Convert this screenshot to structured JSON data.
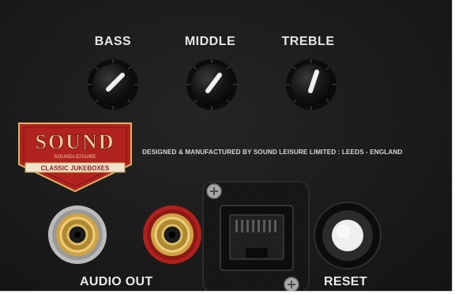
{
  "controls": {
    "bass_label": "BASS",
    "middle_label": "MIDDLE",
    "treble_label": "TREBLE"
  },
  "logo": {
    "brand": "SOUND",
    "subtitle": "SOUNDLEISURE",
    "banner": "CLASSIC JUKEBOXES"
  },
  "maker_text": "DESIGNED & MANUFACTURED BY SOUND LEISURE LIMITED : LEEDS - ENGLAND",
  "audio_out_label": "AUDIO OUT",
  "reset_label": "RESET",
  "colors": {
    "panel": "#1c1c1c",
    "label_text": "#e9e9e9",
    "badge_red": "#b3211e",
    "badge_gold": "#d7a64a",
    "jack_gold": "#c9a24a"
  },
  "icons": [
    "knob-icon",
    "rca-jack-icon",
    "ethernet-port-icon",
    "screw-icon",
    "reset-button-icon"
  ]
}
